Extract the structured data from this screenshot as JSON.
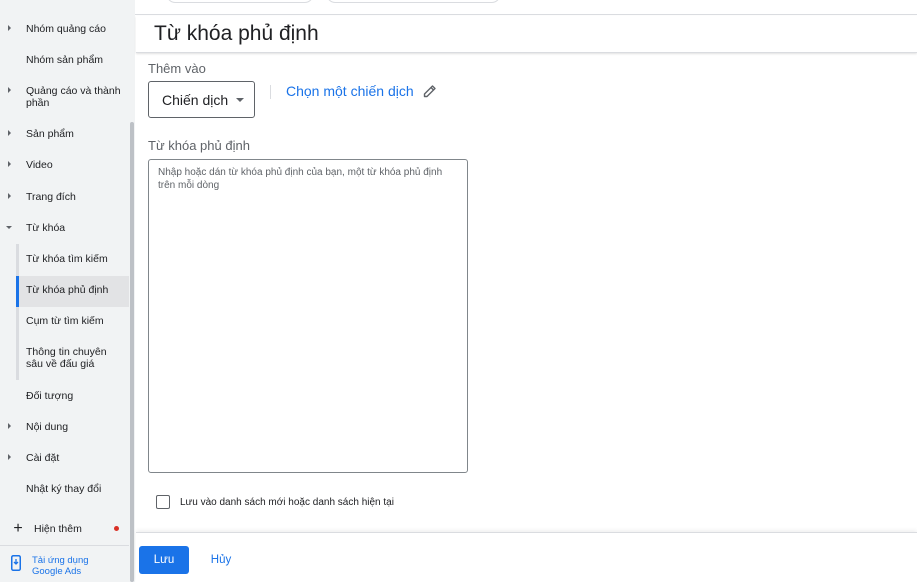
{
  "sidebar": {
    "items": [
      {
        "label": "Nhóm quảng cáo"
      },
      {
        "label": "Nhóm sản phẩm"
      },
      {
        "label": "Quảng cáo và thành phần"
      },
      {
        "label": "Sản phẩm"
      },
      {
        "label": "Video"
      },
      {
        "label": "Trang đích"
      },
      {
        "label": "Từ khóa"
      },
      {
        "label": "Từ khóa tìm kiếm"
      },
      {
        "label": "Từ khóa phủ định"
      },
      {
        "label": "Cụm từ tìm kiếm"
      },
      {
        "label": "Thông tin chuyên sâu về đấu giá"
      },
      {
        "label": "Đối tượng"
      },
      {
        "label": "Nội dung"
      },
      {
        "label": "Cài đặt"
      },
      {
        "label": "Nhật ký thay đổi"
      }
    ],
    "active_item": "Từ khóa phủ định",
    "more_label": "Hiện thêm",
    "app_download_line1": "Tải ứng dụng",
    "app_download_line2": "Google Ads"
  },
  "main": {
    "title": "Từ khóa phủ định",
    "add_to_label": "Thêm vào",
    "campaign_dropdown_value": "Chiến dịch",
    "choose_campaign_link": "Chọn một chiến dịch",
    "keywords_label": "Từ khóa phủ định",
    "keywords_placeholder": "Nhập hoặc dán từ khóa phủ định của bạn, một từ khóa phủ định trên mỗi dòng",
    "keywords_value": "",
    "save_to_list_label": "Lưu vào danh sách mới hoặc danh sách hiện tại",
    "save_to_list_checked": false
  },
  "footer": {
    "save_label": "Lưu",
    "cancel_label": "Hủy"
  },
  "colors": {
    "accent": "#1a73e8",
    "sidebar_bg": "#f1f3f4",
    "notification_dot": "#d93025"
  },
  "icons": [
    "caret-right-icon",
    "caret-down-icon",
    "plus-icon",
    "phone-icon",
    "pencil-icon",
    "dropdown-caret-icon"
  ]
}
